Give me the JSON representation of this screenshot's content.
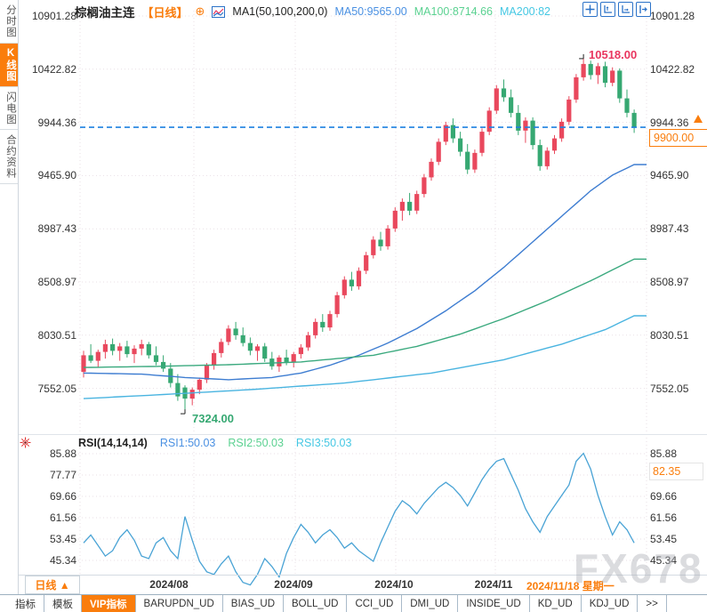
{
  "header": {
    "symbol": "棕榈油主连",
    "period_tag": "【日线】",
    "expand_icon": "⊕",
    "ma_settings": "MA1(50,100,200,0)",
    "ma50": "MA50:9565.00",
    "ma100": "MA100:8714.66",
    "ma200": "MA200:82"
  },
  "sidebar": {
    "items": [
      {
        "label": "分时图",
        "active": false
      },
      {
        "label": "K线图",
        "active": true
      },
      {
        "label": "闪电图",
        "active": false
      },
      {
        "label": "合约资料",
        "active": false
      }
    ]
  },
  "price_axis": {
    "labels": [
      "10901.28",
      "10422.82",
      "9944.36",
      "9465.90",
      "8987.43",
      "8508.97",
      "8030.51",
      "7552.05"
    ]
  },
  "annotations": {
    "high_label": "10518.00",
    "low_label": "7324.00",
    "last_price": "9900.00",
    "rsi_marker": "82.35"
  },
  "rsi": {
    "title": "RSI(14,14,14)",
    "rsi1": "RSI1:50.03",
    "rsi2": "RSI2:50.03",
    "rsi3": "RSI3:50.03",
    "axis_labels": [
      "85.88",
      "77.77",
      "69.66",
      "61.56",
      "53.45",
      "45.34"
    ]
  },
  "xaxis": {
    "period_selector": "日线 ▲",
    "labels": [
      "2024/08",
      "2024/09",
      "2024/10",
      "2024/11"
    ],
    "current_date": "2024/11/18 星期一"
  },
  "toolbar": {
    "items": [
      {
        "label": "指标",
        "active": false
      },
      {
        "label": "模板",
        "active": false
      },
      {
        "label": "VIP指标",
        "active": true
      },
      {
        "label": "BARUPDN_UD",
        "active": false
      },
      {
        "label": "BIAS_UD",
        "active": false
      },
      {
        "label": "BOLL_UD",
        "active": false
      },
      {
        "label": "CCI_UD",
        "active": false
      },
      {
        "label": "DMI_UD",
        "active": false
      },
      {
        "label": "INSIDE_UD",
        "active": false
      },
      {
        "label": "KD_UD",
        "active": false
      },
      {
        "label": "KDJ_UD",
        "active": false
      },
      {
        "label": ">>",
        "active": false
      }
    ]
  },
  "watermark": "FX678",
  "colors": {
    "up": "#e9485d",
    "down": "#36a872",
    "ma50": "#3e7dd1",
    "ma100": "#3aa97e",
    "ma200": "#49b4e0",
    "rsi_line": "#49a3d5",
    "dashed_last": "#1f80e0",
    "accent_orange": "#fa7d0c",
    "high_text": "#e9365f",
    "low_text": "#36a872",
    "grid": "#e9dfe6"
  },
  "chart_data": {
    "type": "candlestick",
    "symbol": "棕榈油主连 (Palm Oil Continuous)",
    "period": "日线 (Daily)",
    "price_axis_ticks": [
      10901.28,
      10422.82,
      9944.36,
      9465.9,
      8987.43,
      8508.97,
      8030.51,
      7552.05
    ],
    "high": 10518.0,
    "low": 7324.0,
    "last": 9900.0,
    "x_labels": [
      "2024/08",
      "2024/09",
      "2024/10",
      "2024/11",
      "2024/11/18 星期一"
    ],
    "candles_ohlc": [
      [
        7700,
        7890,
        7650,
        7850
      ],
      [
        7850,
        7950,
        7780,
        7800
      ],
      [
        7800,
        7900,
        7740,
        7880
      ],
      [
        7880,
        7990,
        7820,
        7950
      ],
      [
        7950,
        8000,
        7850,
        7890
      ],
      [
        7890,
        7960,
        7800,
        7930
      ],
      [
        7930,
        7980,
        7830,
        7860
      ],
      [
        7860,
        7940,
        7780,
        7910
      ],
      [
        7910,
        7990,
        7850,
        7950
      ],
      [
        7950,
        7970,
        7820,
        7850
      ],
      [
        7850,
        7930,
        7760,
        7790
      ],
      [
        7790,
        7850,
        7700,
        7730
      ],
      [
        7730,
        7780,
        7560,
        7600
      ],
      [
        7600,
        7680,
        7440,
        7480
      ],
      [
        7560,
        7580,
        7324,
        7460
      ],
      [
        7460,
        7560,
        7400,
        7540
      ],
      [
        7540,
        7650,
        7500,
        7630
      ],
      [
        7630,
        7780,
        7600,
        7760
      ],
      [
        7760,
        7900,
        7720,
        7870
      ],
      [
        7870,
        8000,
        7830,
        7970
      ],
      [
        7970,
        8120,
        7940,
        8090
      ],
      [
        8090,
        8150,
        7990,
        8030
      ],
      [
        8030,
        8100,
        7930,
        7960
      ],
      [
        7960,
        8010,
        7850,
        7890
      ],
      [
        7890,
        7950,
        7800,
        7930
      ],
      [
        7930,
        7960,
        7790,
        7820
      ],
      [
        7820,
        7880,
        7720,
        7750
      ],
      [
        7750,
        7850,
        7700,
        7830
      ],
      [
        7830,
        7900,
        7760,
        7790
      ],
      [
        7790,
        7880,
        7740,
        7860
      ],
      [
        7860,
        7950,
        7820,
        7920
      ],
      [
        7920,
        8060,
        7890,
        8030
      ],
      [
        8030,
        8180,
        8000,
        8150
      ],
      [
        8150,
        8220,
        8060,
        8100
      ],
      [
        8100,
        8250,
        8070,
        8220
      ],
      [
        8220,
        8420,
        8190,
        8390
      ],
      [
        8390,
        8560,
        8360,
        8530
      ],
      [
        8530,
        8600,
        8430,
        8470
      ],
      [
        8470,
        8640,
        8440,
        8610
      ],
      [
        8610,
        8780,
        8580,
        8750
      ],
      [
        8750,
        8920,
        8720,
        8890
      ],
      [
        8890,
        8960,
        8790,
        8830
      ],
      [
        8830,
        9020,
        8800,
        8990
      ],
      [
        8990,
        9180,
        8960,
        9150
      ],
      [
        9150,
        9260,
        9060,
        9230
      ],
      [
        9230,
        9310,
        9110,
        9150
      ],
      [
        9150,
        9330,
        9120,
        9300
      ],
      [
        9300,
        9480,
        9270,
        9450
      ],
      [
        9450,
        9620,
        9420,
        9590
      ],
      [
        9590,
        9800,
        9560,
        9770
      ],
      [
        9770,
        9950,
        9740,
        9920
      ],
      [
        9920,
        9980,
        9760,
        9800
      ],
      [
        9800,
        9860,
        9640,
        9680
      ],
      [
        9680,
        9750,
        9480,
        9520
      ],
      [
        9520,
        9700,
        9490,
        9670
      ],
      [
        9670,
        9890,
        9640,
        9860
      ],
      [
        9860,
        10080,
        9830,
        10050
      ],
      [
        10050,
        10280,
        10020,
        10250
      ],
      [
        10250,
        10330,
        10130,
        10170
      ],
      [
        10170,
        10240,
        9990,
        10030
      ],
      [
        10030,
        10100,
        9830,
        9870
      ],
      [
        9870,
        9990,
        9760,
        9960
      ],
      [
        9960,
        9990,
        9700,
        9740
      ],
      [
        9740,
        9790,
        9510,
        9550
      ],
      [
        9550,
        9720,
        9520,
        9690
      ],
      [
        9690,
        9830,
        9660,
        9800
      ],
      [
        9800,
        9980,
        9770,
        9950
      ],
      [
        9950,
        10180,
        9920,
        10150
      ],
      [
        10150,
        10380,
        10120,
        10350
      ],
      [
        10350,
        10518,
        10320,
        10470
      ],
      [
        10470,
        10500,
        10330,
        10370
      ],
      [
        10370,
        10480,
        10290,
        10450
      ],
      [
        10450,
        10490,
        10260,
        10300
      ],
      [
        10300,
        10440,
        10270,
        10410
      ],
      [
        10410,
        10430,
        10120,
        10160
      ],
      [
        10160,
        10240,
        9990,
        10030
      ],
      [
        10030,
        10060,
        9850,
        9900
      ]
    ],
    "ma_series": [
      {
        "name": "MA50",
        "last": 9565.0,
        "anchors": [
          [
            0,
            7690
          ],
          [
            8,
            7680
          ],
          [
            14,
            7650
          ],
          [
            20,
            7630
          ],
          [
            26,
            7650
          ],
          [
            30,
            7690
          ],
          [
            34,
            7760
          ],
          [
            38,
            7850
          ],
          [
            42,
            7960
          ],
          [
            46,
            8090
          ],
          [
            50,
            8250
          ],
          [
            54,
            8430
          ],
          [
            58,
            8640
          ],
          [
            62,
            8870
          ],
          [
            66,
            9100
          ],
          [
            70,
            9330
          ],
          [
            73,
            9470
          ],
          [
            76,
            9565
          ]
        ]
      },
      {
        "name": "MA100",
        "last": 8714.66,
        "anchors": [
          [
            0,
            7740
          ],
          [
            10,
            7750
          ],
          [
            20,
            7765
          ],
          [
            30,
            7790
          ],
          [
            40,
            7850
          ],
          [
            46,
            7930
          ],
          [
            52,
            8040
          ],
          [
            58,
            8180
          ],
          [
            64,
            8340
          ],
          [
            70,
            8520
          ],
          [
            76,
            8715
          ]
        ]
      },
      {
        "name": "MA200",
        "last": 8205,
        "anchors": [
          [
            0,
            7460
          ],
          [
            12,
            7500
          ],
          [
            24,
            7545
          ],
          [
            36,
            7600
          ],
          [
            48,
            7690
          ],
          [
            58,
            7810
          ],
          [
            66,
            7950
          ],
          [
            72,
            8080
          ],
          [
            76,
            8205
          ]
        ]
      }
    ],
    "rsi_series": {
      "name": "RSI1",
      "current_axis_value": 82.35,
      "axis_ticks": [
        85.88,
        77.77,
        69.66,
        61.56,
        53.45,
        45.34
      ],
      "values": [
        52,
        55,
        51,
        47,
        49,
        54,
        57,
        53,
        47,
        46,
        52,
        54,
        49,
        46,
        62,
        53,
        45,
        41,
        40,
        44,
        47,
        41,
        37,
        36,
        40,
        46,
        43,
        39,
        48,
        54,
        59,
        56,
        52,
        55,
        57,
        54,
        50,
        52,
        49,
        47,
        45,
        52,
        58,
        64,
        68,
        66,
        63,
        67,
        70,
        73,
        75,
        73,
        70,
        66,
        71,
        76,
        80,
        83,
        84,
        78,
        72,
        65,
        60,
        56,
        62,
        66,
        70,
        74,
        83,
        86,
        80,
        70,
        62,
        55,
        60,
        57,
        52
      ]
    }
  }
}
